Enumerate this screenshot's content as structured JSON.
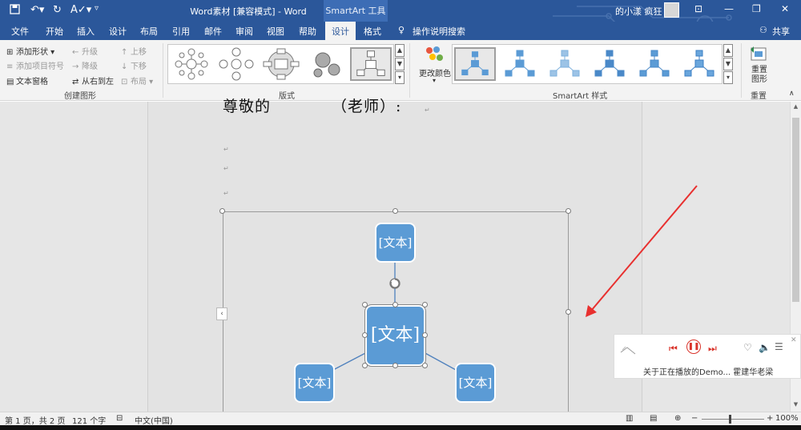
{
  "titlebar": {
    "doc_title": "Word素材 [兼容模式] - Word",
    "contextual_tab": "SmartArt 工具",
    "user_name": "的小漾 疯狂",
    "colors": {
      "bg": "#2b579a"
    }
  },
  "tabs": [
    {
      "label": "文件"
    },
    {
      "label": "开始"
    },
    {
      "label": "插入"
    },
    {
      "label": "设计"
    },
    {
      "label": "布局"
    },
    {
      "label": "引用"
    },
    {
      "label": "邮件"
    },
    {
      "label": "审阅"
    },
    {
      "label": "视图"
    },
    {
      "label": "帮助"
    },
    {
      "label": "设计"
    },
    {
      "label": "格式"
    }
  ],
  "tell_me": "操作说明搜索",
  "share": "共享",
  "ribbon": {
    "create_graphic": {
      "add_shape": "添加形状",
      "add_bullet": "添加项目符号",
      "text_pane": "文本窗格",
      "promote": "升级",
      "demote": "降级",
      "right_to_left": "从右到左",
      "move_up": "上移",
      "move_down": "下移",
      "layout": "布局",
      "group_label": "创建图形"
    },
    "layouts_label": "版式",
    "change_colors": "更改颜色",
    "styles_label": "SmartArt 样式",
    "reset_graphic": "重置图形",
    "reset_label": "重置"
  },
  "document": {
    "heading_left": "尊敬的",
    "heading_right": "（老师）:",
    "smartart_nodes": [
      {
        "label": "[文本]"
      },
      {
        "label": "[文本]"
      },
      {
        "label": "[文本]"
      },
      {
        "label": "[文本]"
      }
    ],
    "node_color": "#5b9bd5"
  },
  "music_player": {
    "song_title": "关于正在播放的Demo... 霍建华老梁"
  },
  "statusbar": {
    "page": "第 1 页，共 2 页",
    "words": "121 个字",
    "language": "中文(中国)",
    "zoom": "100%"
  }
}
